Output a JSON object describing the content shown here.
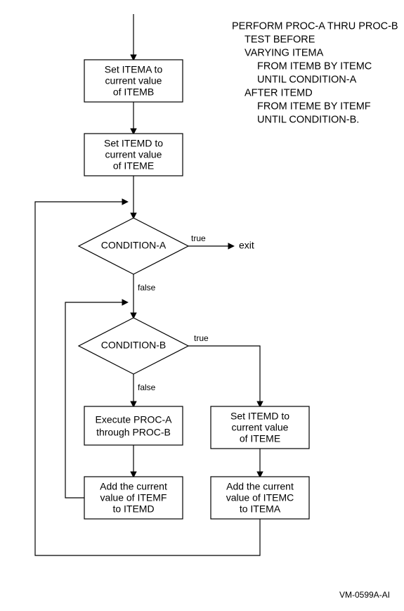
{
  "boxes": {
    "setA": {
      "l1": "Set ITEMA to",
      "l2": "current value",
      "l3": "of ITEMB"
    },
    "setD": {
      "l1": "Set ITEMD to",
      "l2": "current value",
      "l3": "of ITEME"
    },
    "condA": "CONDITION-A",
    "condB": "CONDITION-B",
    "exec": {
      "l1": "Execute PROC-A",
      "l2": "through PROC-B"
    },
    "setD2": {
      "l1": "Set ITEMD to",
      "l2": "current value",
      "l3": "of ITEME"
    },
    "addF": {
      "l1": "Add the current",
      "l2": "value of ITEMF",
      "l3": "to ITEMD"
    },
    "addC": {
      "l1": "Add the current",
      "l2": "value of ITEMC",
      "l3": "to ITEMA"
    }
  },
  "labels": {
    "trueA": "true",
    "falseA": "false",
    "trueB": "true",
    "falseB": "false",
    "exit": "exit"
  },
  "code": [
    {
      "indent": 0,
      "text": "PERFORM PROC-A THRU PROC-B"
    },
    {
      "indent": 1,
      "text": "TEST BEFORE"
    },
    {
      "indent": 1,
      "text": "VARYING ITEMA"
    },
    {
      "indent": 2,
      "text": "FROM ITEMB BY ITEMC"
    },
    {
      "indent": 2,
      "text": "UNTIL CONDITION-A"
    },
    {
      "indent": 1,
      "text": "AFTER ITEMD"
    },
    {
      "indent": 2,
      "text": "FROM ITEME BY ITEMF"
    },
    {
      "indent": 2,
      "text": "UNTIL CONDITION-B."
    }
  ],
  "footer": "VM-0599A-AI"
}
